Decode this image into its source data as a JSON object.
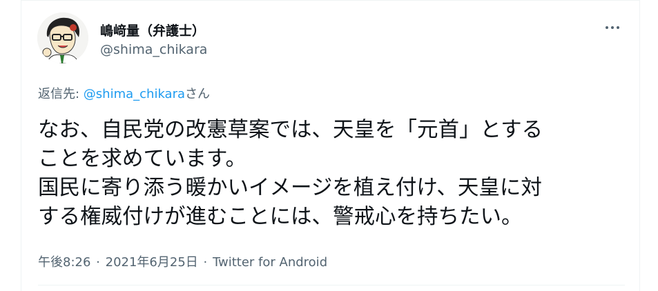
{
  "author": {
    "display_name": "嶋﨑量（弁護士）",
    "handle": "@shima_chikara"
  },
  "reply": {
    "prefix": "返信先: ",
    "mention": "@shima_chikara",
    "suffix": "さん"
  },
  "tweet": {
    "lines": [
      "なお、自民党の改憲草案では、天皇を「元首」とする",
      "ことを求めています。",
      "国民に寄り添う暖かいイメージを植え付け、天皇に対",
      "する権威付けが進むことには、警戒心を持ちたい。"
    ]
  },
  "meta": {
    "time": "午後8:26",
    "separator": "·",
    "date": "2021年6月25日",
    "source": "Twitter for Android"
  },
  "icons": {
    "more": "more-horizontal-icon",
    "avatar": "avatar"
  },
  "colors": {
    "link": "#1d9bf0",
    "secondary_text": "#536471",
    "primary_text": "#0f1419"
  }
}
